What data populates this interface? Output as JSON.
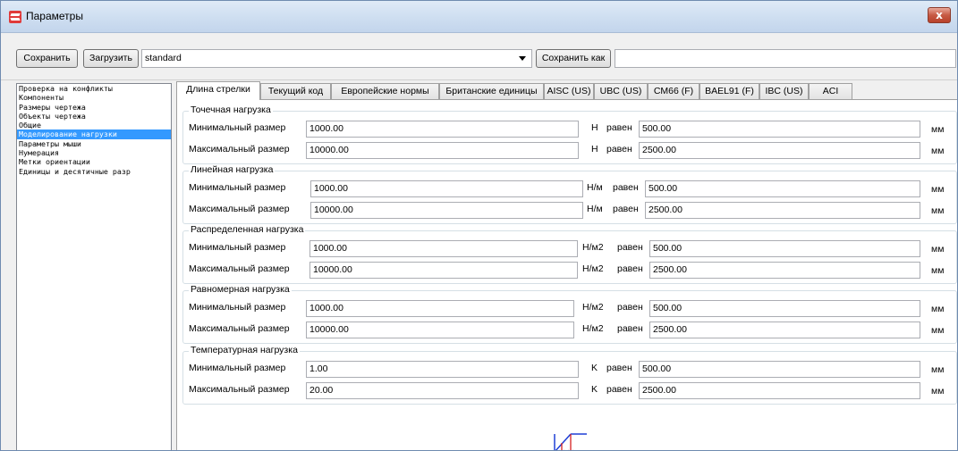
{
  "window": {
    "title": "Параметры",
    "close_label": "x"
  },
  "toolbar": {
    "save_label": "Сохранить",
    "load_label": "Загрузить",
    "preset_value": "standard",
    "save_as_label": "Сохранить как",
    "name_value": ""
  },
  "sidebar": {
    "items": [
      {
        "label": "Проверка на конфликты",
        "selected": false
      },
      {
        "label": "Компоненты",
        "selected": false
      },
      {
        "label": "Размеры чертежа",
        "selected": false
      },
      {
        "label": "Объекты чертежа",
        "selected": false
      },
      {
        "label": "Общие",
        "selected": false
      },
      {
        "label": "Моделирование нагрузки",
        "selected": true
      },
      {
        "label": "Параметры мыши",
        "selected": false
      },
      {
        "label": "Нумерация",
        "selected": false
      },
      {
        "label": "Метки ориентации",
        "selected": false
      },
      {
        "label": "Единицы и десятичные разр",
        "selected": false
      }
    ]
  },
  "tabs": [
    {
      "label": "Длина стрелки",
      "active": true
    },
    {
      "label": "Текущий код",
      "active": false
    },
    {
      "label": "Европейские нормы",
      "active": false
    },
    {
      "label": "Британские единицы",
      "active": false
    },
    {
      "label": "AISC (US)",
      "active": false
    },
    {
      "label": "UBC (US)",
      "active": false
    },
    {
      "label": "CM66 (F)",
      "active": false
    },
    {
      "label": "BAEL91 (F)",
      "active": false
    },
    {
      "label": "IBC (US)",
      "active": false
    },
    {
      "label": "ACI",
      "active": false
    }
  ],
  "labels": {
    "min": "Минимальный размер",
    "max": "Максимальный размер",
    "equals": "равен",
    "mm": "мм"
  },
  "groups": [
    {
      "title": "Точечная нагрузка",
      "unit": "Н",
      "min_value": "1000.00",
      "min_eq": "500.00",
      "max_value": "10000.00",
      "max_eq": "2500.00"
    },
    {
      "title": "Линейная нагрузка",
      "unit": "Н/м",
      "min_value": "1000.00",
      "min_eq": "500.00",
      "max_value": "10000.00",
      "max_eq": "2500.00"
    },
    {
      "title": "Распределенная нагрузка",
      "unit": "Н/м2",
      "min_value": "1000.00",
      "min_eq": "500.00",
      "max_value": "10000.00",
      "max_eq": "2500.00"
    },
    {
      "title": "Равномерная нагрузка",
      "unit": "Н/м2",
      "min_value": "1000.00",
      "min_eq": "500.00",
      "max_value": "10000.00",
      "max_eq": "2500.00"
    },
    {
      "title": "Температурная нагрузка",
      "unit": "K",
      "min_value": "1.00",
      "min_eq": "500.00",
      "max_value": "20.00",
      "max_eq": "2500.00"
    }
  ],
  "colors": {
    "selection": "#3399ff",
    "preview_line": "#1f3fd6",
    "preview_arrow": "#d62020"
  }
}
